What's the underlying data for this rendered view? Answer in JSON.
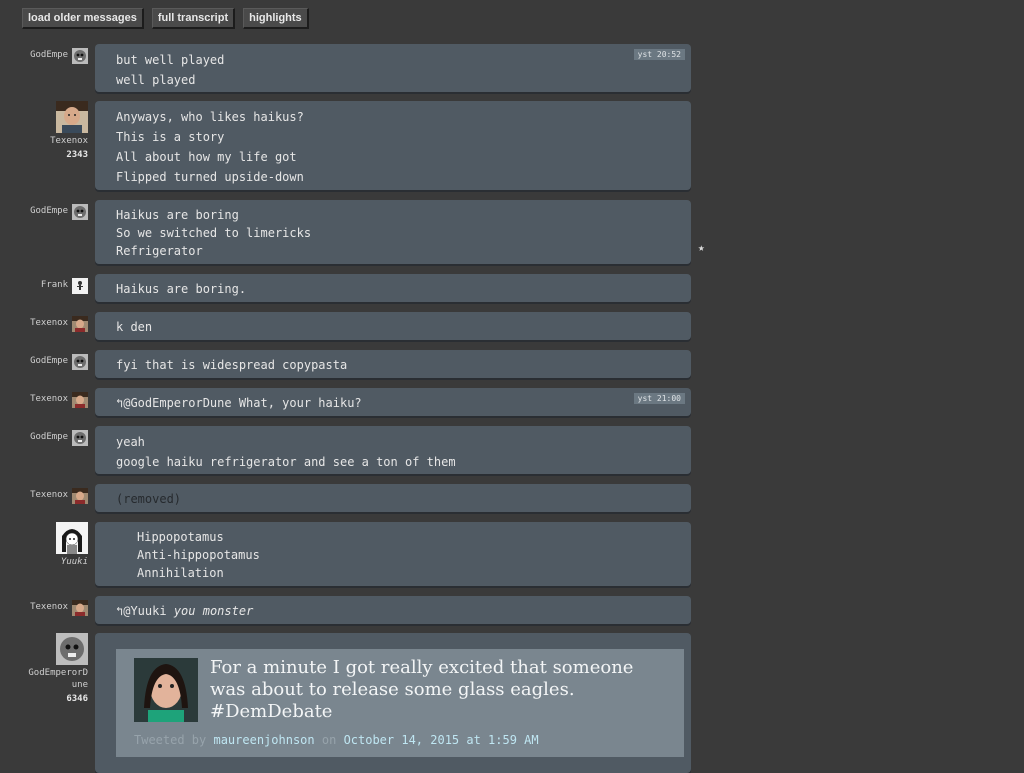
{
  "toolbar": {
    "load_older": "load older messages",
    "full_transcript": "full transcript",
    "highlights": "highlights"
  },
  "messages": [
    {
      "user": "GodEmpe",
      "lines": [
        "but well played",
        "well played"
      ],
      "timestamp": "yst 20:52"
    },
    {
      "user": "Texenox",
      "reputation": "2343",
      "lines": [
        "Anyways, who likes haikus?",
        "This is a story",
        "All about how my life got",
        "Flipped turned upside-down"
      ]
    },
    {
      "user": "GodEmpe",
      "lines": [
        "Haikus are boring",
        "So we switched to limericks",
        "Refrigerator"
      ],
      "star": "★"
    },
    {
      "user": "Frank",
      "lines": [
        "Haikus are boring."
      ]
    },
    {
      "user": "Texenox",
      "lines": [
        "k den"
      ]
    },
    {
      "user": "GodEmpe",
      "lines": [
        "fyi that is widespread copypasta"
      ]
    },
    {
      "user": "Texenox",
      "reply_icon": "↰",
      "mention": "@GodEmperorDune",
      "text": " What, your haiku?",
      "timestamp": "yst 21:00"
    },
    {
      "user": "GodEmpe",
      "lines": [
        "yeah",
        "google haiku refrigerator and see a ton of them"
      ]
    },
    {
      "user": "Texenox",
      "lines": [
        "(removed)"
      ]
    },
    {
      "user": "Yuuki",
      "lines": [
        "Hippopotamus",
        "Anti-hippopotamus",
        "Annihilation"
      ]
    },
    {
      "user": "Texenox",
      "reply_icon": "↰",
      "mention": "@Yuuki",
      "text": "you monster"
    },
    {
      "user_line1": "GodEmperorD",
      "user_line2": "une",
      "reputation": "6346"
    }
  ],
  "tweet": {
    "text": "For a minute I got really excited that someone was about to release some glass eagles. #DemDebate",
    "tweeted_by": "Tweeted by",
    "author": "maureenjohnson",
    "on": "on",
    "date": "October 14, 2015 at 1:59 AM"
  },
  "colors": {
    "background": "#3a3a3a",
    "bubble": "#505a63",
    "tweet_box": "#7a868f",
    "link": "#bfe6f2"
  },
  "icons": {
    "godempe_avatar": "dog-face-icon",
    "texenox_avatar": "person-photo-icon",
    "frank_avatar": "dot-figure-icon",
    "yuuki_avatar": "anime-girl-icon",
    "reply": "reply-arrow-icon"
  }
}
